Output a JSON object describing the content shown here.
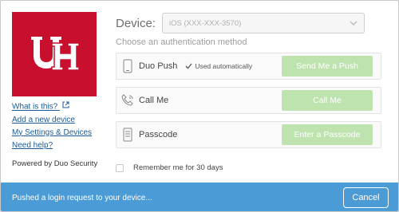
{
  "colors": {
    "brand_red": "#c8102e",
    "link_blue": "#1a5a96",
    "button_disabled_green": "#bfe3ae",
    "status_bar_blue": "#4a9bd6"
  },
  "logo": {
    "icon": "uh-logo"
  },
  "sidebar": {
    "links": [
      {
        "label": "What is this?",
        "icon": "external-link-icon"
      },
      {
        "label": "Add a new device"
      },
      {
        "label": "My Settings & Devices"
      },
      {
        "label": "Need help?"
      }
    ],
    "powered_by": "Powered by Duo Security"
  },
  "device": {
    "label": "Device:",
    "selected": "iOS (XXX-XXX-3570)"
  },
  "choose_method": "Choose an authentication method",
  "methods": [
    {
      "icon": "phone-icon",
      "label": "Duo Push",
      "note": "Used automatically",
      "note_icon": "checkmark-icon",
      "button": "Send Me a Push"
    },
    {
      "icon": "phone-call-icon",
      "label": "Call Me",
      "button": "Call Me"
    },
    {
      "icon": "passcode-icon",
      "label": "Passcode",
      "button": "Enter a Passcode"
    }
  ],
  "remember": {
    "label": "Remember me for 30 days",
    "checked": false
  },
  "status": {
    "message": "Pushed a login request to your device...",
    "cancel_label": "Cancel"
  }
}
